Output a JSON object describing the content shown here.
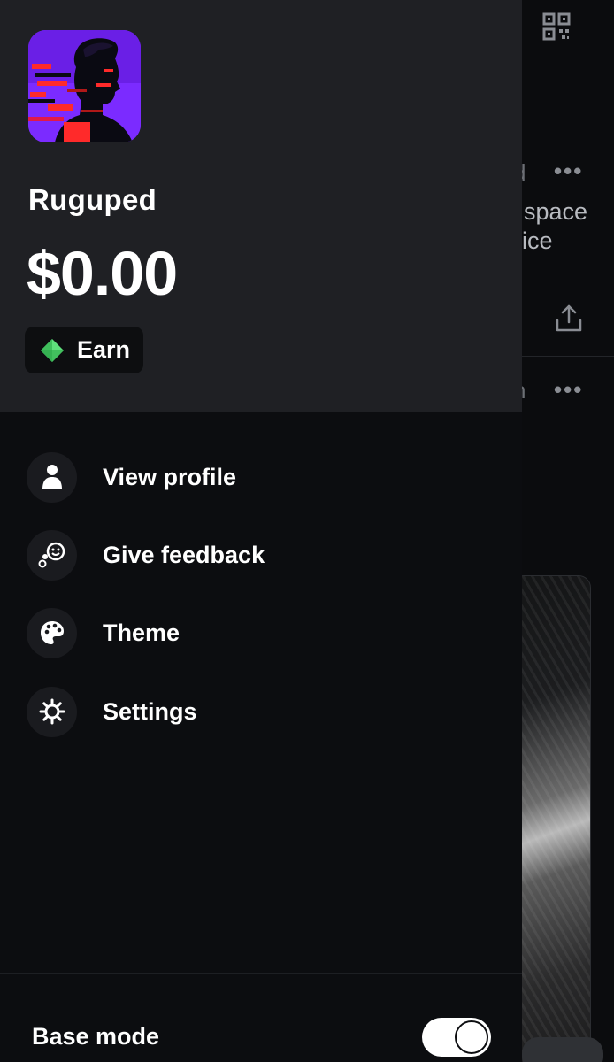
{
  "profile": {
    "username": "Ruguped",
    "balance": "$0.00",
    "earn_label": "Earn"
  },
  "menu": {
    "items": [
      {
        "label": "View profile",
        "icon": "person-icon"
      },
      {
        "label": "Give feedback",
        "icon": "feedback-icon"
      },
      {
        "label": "Theme",
        "icon": "palette-icon"
      },
      {
        "label": "Settings",
        "icon": "gear-icon"
      }
    ]
  },
  "footer": {
    "base_mode_label": "Base mode",
    "base_mode_on": true
  },
  "background_feed": {
    "text_fragments": [
      "d",
      "space",
      "ice",
      "n"
    ]
  },
  "colors": {
    "drawer_header": "#1f2024",
    "drawer_body": "#0c0d10",
    "earn_icon": "#5fe07c",
    "avatar_bg": "#7b2bff",
    "avatar_accent": "#ff2a2a"
  }
}
